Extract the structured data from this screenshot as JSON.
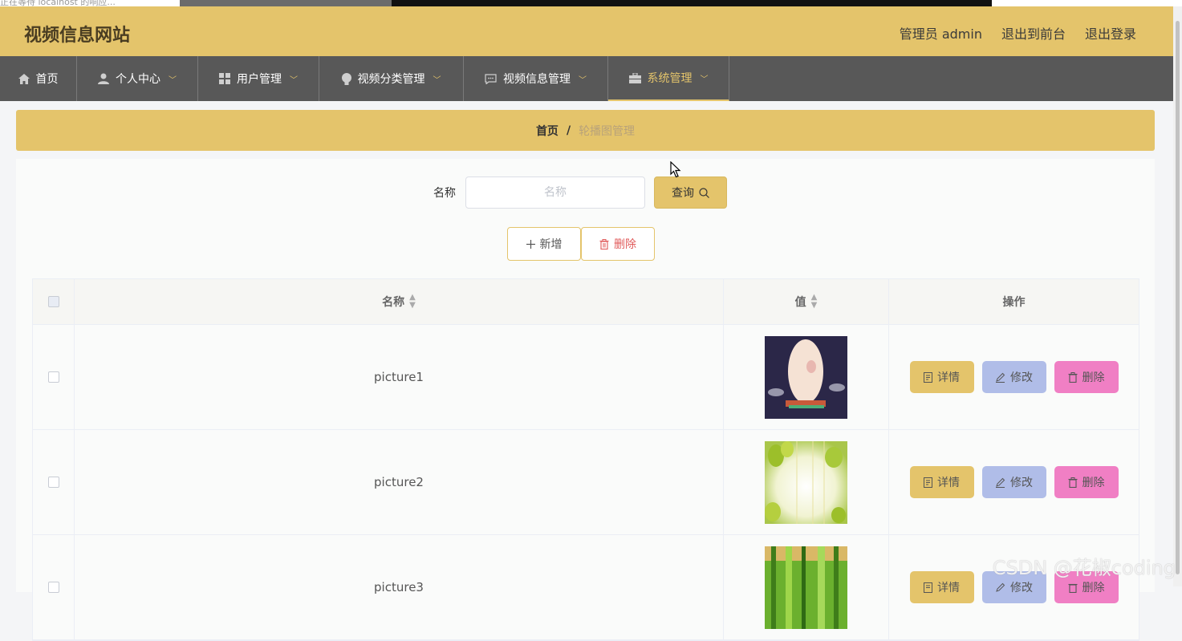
{
  "browser": {
    "status_text": "正在等待 localhost 的响应..."
  },
  "header": {
    "site_title": "视频信息网站",
    "admin_label": "管理员 admin",
    "front_link": "退出到前台",
    "logout_link": "退出登录"
  },
  "nav": {
    "items": [
      {
        "label": "首页",
        "icon": "home-icon"
      },
      {
        "label": "个人中心",
        "icon": "user-icon"
      },
      {
        "label": "用户管理",
        "icon": "grid-icon"
      },
      {
        "label": "视频分类管理",
        "icon": "bulb-icon"
      },
      {
        "label": "视频信息管理",
        "icon": "message-icon"
      },
      {
        "label": "系统管理",
        "icon": "briefcase-icon"
      }
    ]
  },
  "breadcrumb": {
    "home": "首页",
    "separator": "/",
    "current": "轮播图管理"
  },
  "search": {
    "label": "名称",
    "placeholder": "名称",
    "value": "",
    "button_label": "查询"
  },
  "actions": {
    "add_label": "新增",
    "delete_label": "删除"
  },
  "table": {
    "columns": {
      "name": "名称",
      "value": "值",
      "operations": "操作"
    },
    "rows": [
      {
        "name": "picture1",
        "thumb": "moon-scene"
      },
      {
        "name": "picture2",
        "thumb": "green-leaves"
      },
      {
        "name": "picture3",
        "thumb": "bamboo"
      }
    ],
    "row_actions": {
      "detail": "详情",
      "edit": "修改",
      "delete": "删除"
    }
  },
  "watermark": "CSDN @花椒coding",
  "colors": {
    "accent": "#e4c46b",
    "nav_bg": "#585858",
    "edit_btn": "#b0bde8",
    "delete_btn": "#f07fc4",
    "delete_text": "#e05a5a"
  }
}
